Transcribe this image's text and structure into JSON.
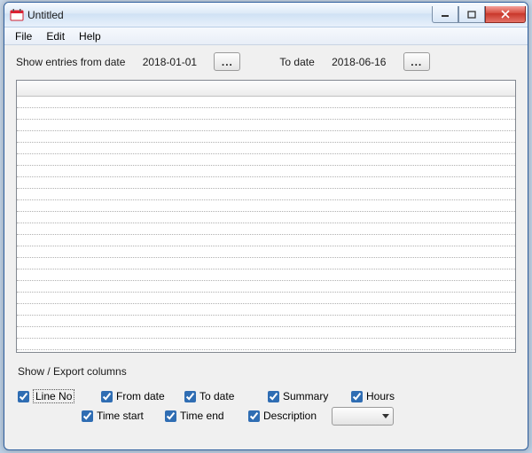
{
  "window": {
    "title": "Untitled"
  },
  "menu": {
    "file": "File",
    "edit": "Edit",
    "help": "Help"
  },
  "filter": {
    "from_label": "Show entries from date",
    "from_value": "2018-01-01",
    "to_label": "To date",
    "to_value": "2018-06-16",
    "dots": "..."
  },
  "columns_group": {
    "title": "Show / Export columns",
    "line_no": "Line No",
    "from_date": "From date",
    "to_date": "To date",
    "summary": "Summary",
    "hours": "Hours",
    "time_start": "Time start",
    "time_end": "Time end",
    "description": "Description"
  },
  "combo": {
    "selected": ""
  }
}
